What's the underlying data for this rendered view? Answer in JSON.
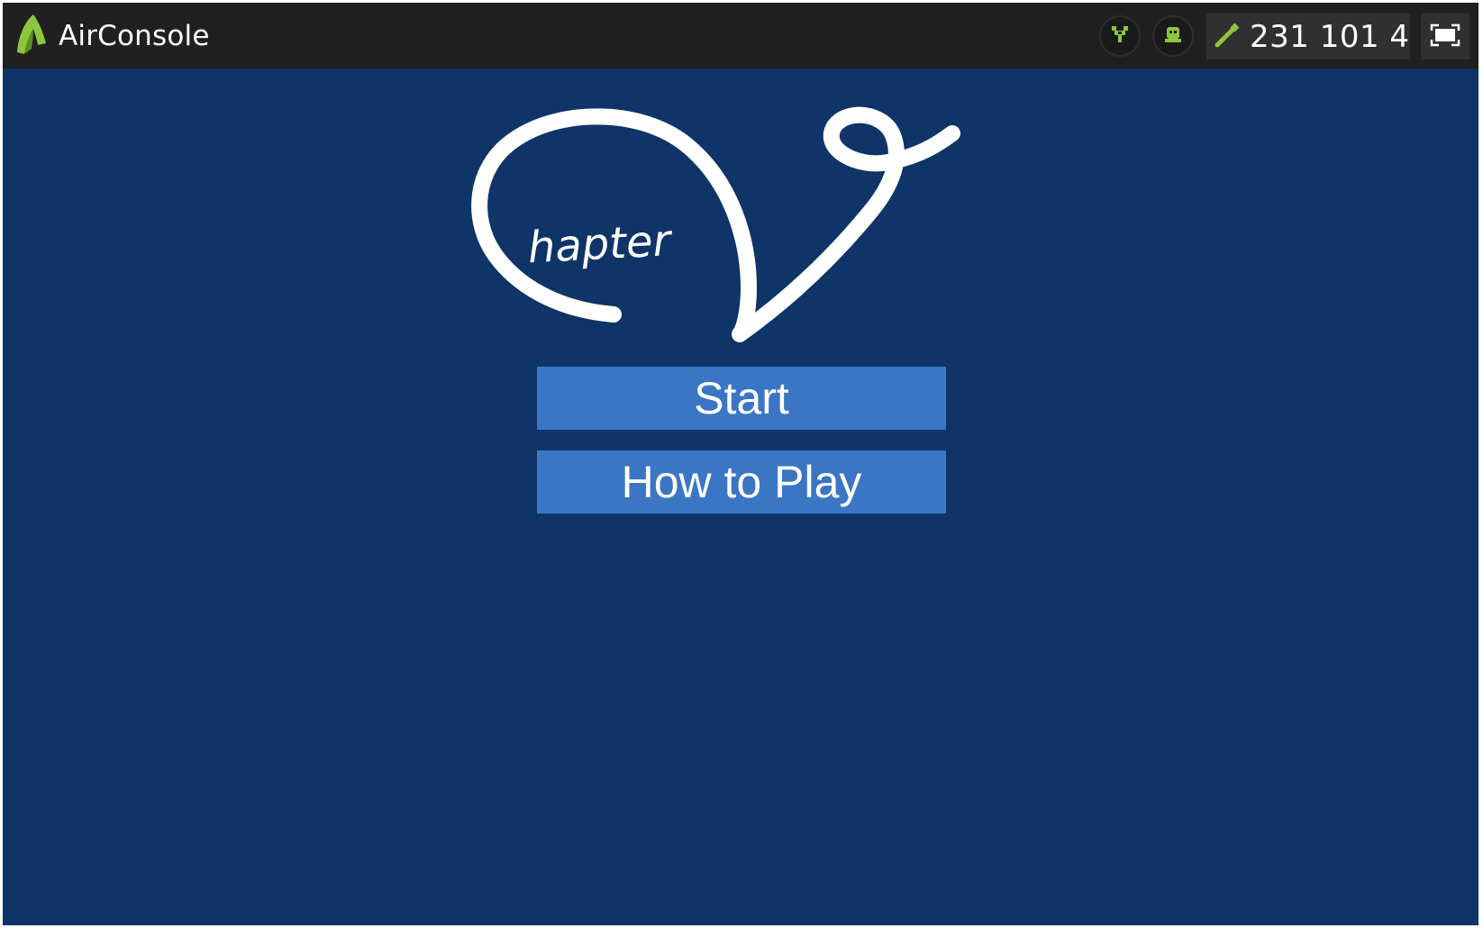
{
  "topbar": {
    "brand": "AirConsole",
    "brand_icon": "airconsole-logo-icon",
    "controller_icon": "controller-icon",
    "player_icon": "player-icon",
    "code_icon": "link-icon",
    "code": "231 101 4",
    "fullscreen_icon": "fullscreen-icon",
    "accent_color": "#8cc63f"
  },
  "game": {
    "logo_text": "hapter",
    "background_color": "#0e3468",
    "button_color": "#3b76c4"
  },
  "menu": {
    "start_label": "Start",
    "how_to_play_label": "How to Play"
  }
}
